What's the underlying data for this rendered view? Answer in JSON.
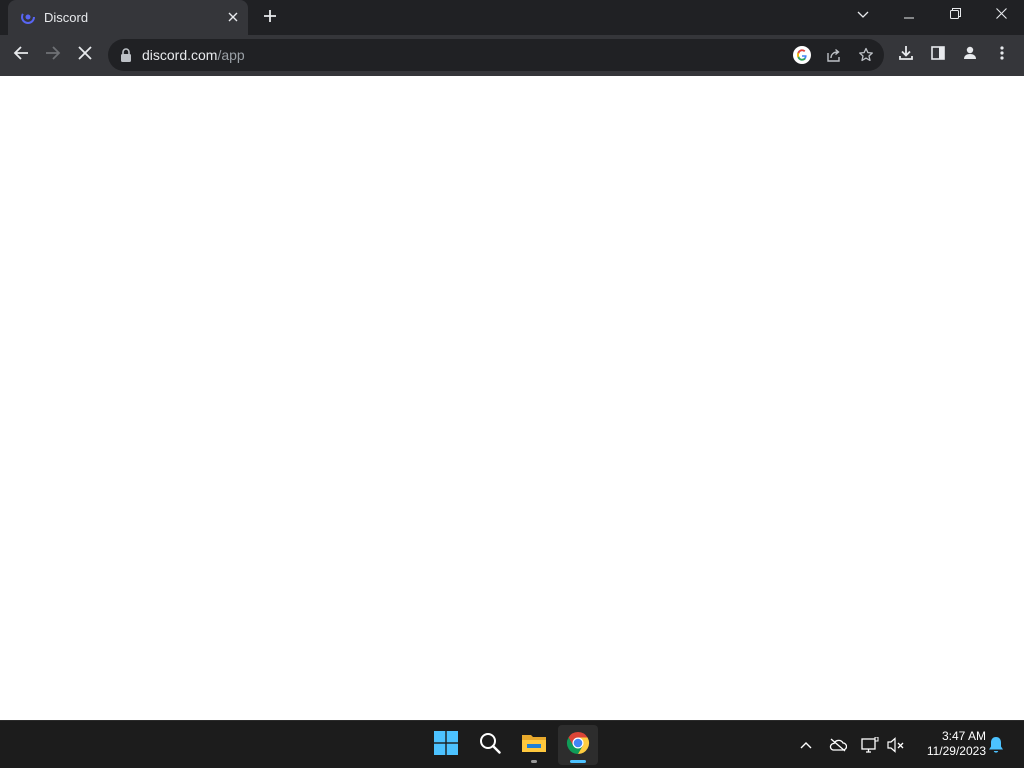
{
  "browser": {
    "tab": {
      "title": "Discord",
      "favicon": "discord-loading-icon"
    },
    "new_tab_icon": "plus-icon",
    "window_controls": [
      "chevron-down-icon",
      "minimize-icon",
      "restore-icon",
      "close-icon"
    ],
    "address": {
      "host": "discord.com",
      "path": "/app",
      "loading": true
    },
    "toolbar_icons": [
      "google-icon",
      "share-icon",
      "bookmark-star-icon",
      "download-icon",
      "side-panel-icon",
      "profile-icon",
      "menu-icon"
    ]
  },
  "taskbar": {
    "apps": [
      "windows-start-icon",
      "search-icon",
      "file-explorer-icon",
      "chrome-icon"
    ],
    "active_app": "chrome-icon",
    "tray_icons": [
      "chevron-up-icon",
      "onedrive-icon",
      "network-icon",
      "volume-muted-icon",
      "notification-bell-icon"
    ],
    "clock": {
      "time": "3:47 AM",
      "date": "11/29/2023"
    }
  },
  "colors": {
    "tabstrip": "#202124",
    "toolbar": "#35363a",
    "taskbar": "#1c1c1c",
    "accent": "#4cc2ff",
    "discord_blurple": "#5865f2"
  }
}
